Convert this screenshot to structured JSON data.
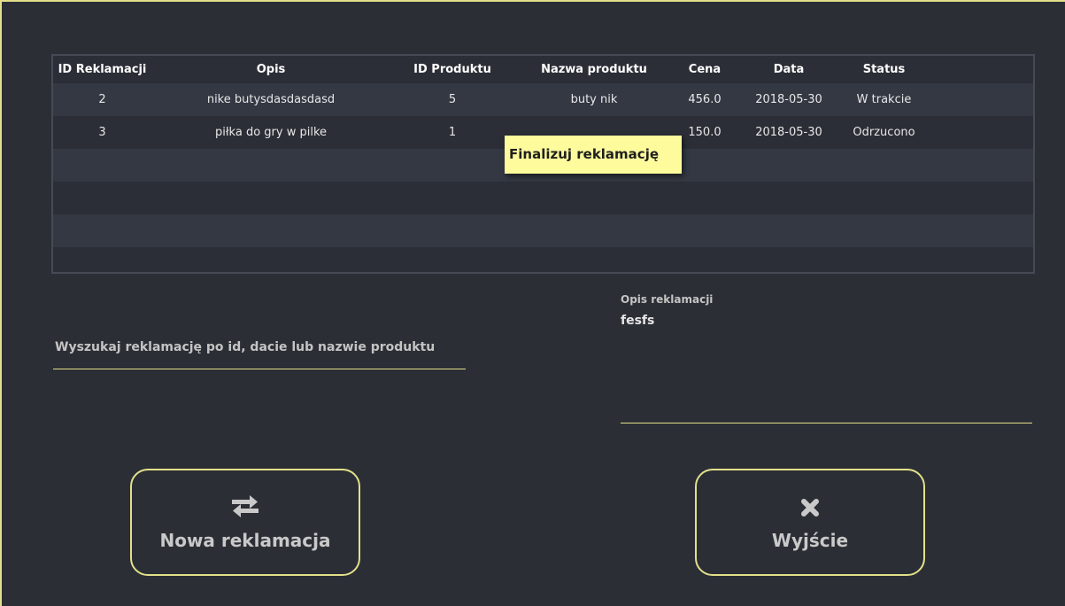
{
  "table": {
    "columns": [
      "ID Reklamacji",
      "Opis",
      "ID Produktu",
      "Nazwa produktu",
      "Cena",
      "Data",
      "Status"
    ],
    "rows": [
      {
        "id": "2",
        "opis": "nike butysdasdasdasd",
        "id_produktu": "5",
        "nazwa": "buty nik",
        "cena": "456.0",
        "data": "2018-05-30",
        "status": "W trakcie"
      },
      {
        "id": "3",
        "opis": "piłka do gry w pilke",
        "id_produktu": "1",
        "nazwa": "",
        "cena": "150.0",
        "data": "2018-05-30",
        "status": "Odrzucono"
      }
    ]
  },
  "tooltip": {
    "text": "Finalizuj reklamację"
  },
  "search": {
    "placeholder": "Wyszukaj reklamację po id, dacie lub nazwie produktu",
    "value": ""
  },
  "description": {
    "label": "Opis reklamacji",
    "value": "fesfs"
  },
  "buttons": {
    "new_complaint": {
      "label": "Nowa reklamacja",
      "icon": "swap-arrows-icon"
    },
    "exit": {
      "label": "Wyjście",
      "icon": "close-x-icon"
    }
  },
  "colors": {
    "background": "#2b2e35",
    "accent": "#e3e08a",
    "tooltip_bg": "#fdfb9c",
    "row_alt": "#343843"
  }
}
